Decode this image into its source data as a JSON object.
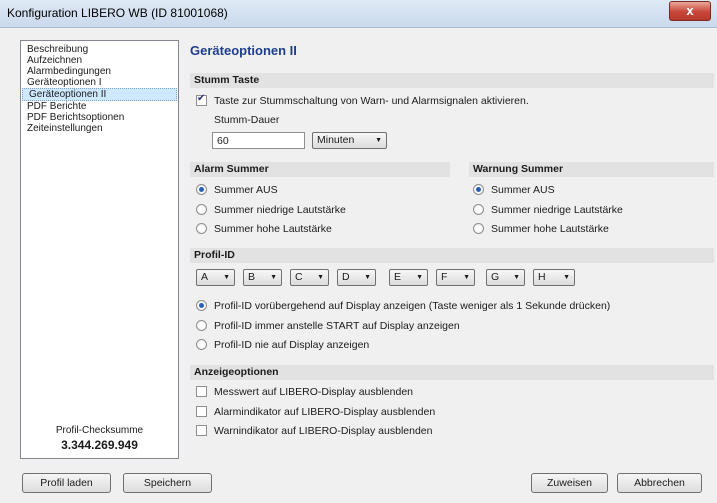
{
  "window": {
    "title": "Konfiguration LIBERO WB (ID 81001068)",
    "close_glyph": "x"
  },
  "nav": {
    "items": [
      {
        "label": "Beschreibung",
        "selected": false
      },
      {
        "label": "Aufzeichnen",
        "selected": false
      },
      {
        "label": "Alarmbedingungen",
        "selected": false
      },
      {
        "label": "Geräteoptionen I",
        "selected": false
      },
      {
        "label": "Geräteoptionen II",
        "selected": true
      },
      {
        "label": "PDF Berichte",
        "selected": false
      },
      {
        "label": "PDF Berichtsoptionen",
        "selected": false
      },
      {
        "label": "Zeiteinstellungen",
        "selected": false
      }
    ],
    "checksum_label": "Profil-Checksumme",
    "checksum_value": "3.344.269.949"
  },
  "main": {
    "title": "Geräteoptionen II",
    "stumm": {
      "header": "Stumm Taste",
      "checkbox_label": "Taste zur Stummschaltung von Warn- und Alarmsignalen aktivieren.",
      "checkbox_checked": true,
      "duration_label": "Stumm-Dauer",
      "duration_value": "60",
      "unit_value": "Minuten"
    },
    "alarm": {
      "header": "Alarm Summer",
      "options": [
        "Summer AUS",
        "Summer niedrige Lautstärke",
        "Summer hohe Lautstärke"
      ],
      "selected": 0
    },
    "warnung": {
      "header": "Warnung Summer",
      "options": [
        "Summer AUS",
        "Summer niedrige Lautstärke",
        "Summer hohe Lautstärke"
      ],
      "selected": 0
    },
    "profil": {
      "header": "Profil-ID",
      "dropdowns": [
        "A",
        "B",
        "C",
        "D",
        "E",
        "F",
        "G",
        "H"
      ],
      "options": [
        "Profil-ID vorübergehend auf Display anzeigen (Taste weniger als 1 Sekunde drücken)",
        "Profil-ID immer anstelle START auf Display anzeigen",
        "Profil-ID nie auf Display anzeigen"
      ],
      "selected": 0
    },
    "anzeige": {
      "header": "Anzeigeoptionen",
      "options": [
        {
          "label": "Messwert auf LIBERO-Display ausblenden",
          "checked": false
        },
        {
          "label": "Alarmindikator auf LIBERO-Display ausblenden",
          "checked": false
        },
        {
          "label": "Warnindikator auf LIBERO-Display ausblenden",
          "checked": false
        }
      ]
    }
  },
  "footer": {
    "load_label": "Profil laden",
    "save_label": "Speichern",
    "assign_label": "Zuweisen",
    "cancel_label": "Abbrechen"
  },
  "colors": {
    "title_blue": "#1e3e8c",
    "selection": "#cde8ff",
    "section_bg": "#e2e2e2"
  }
}
